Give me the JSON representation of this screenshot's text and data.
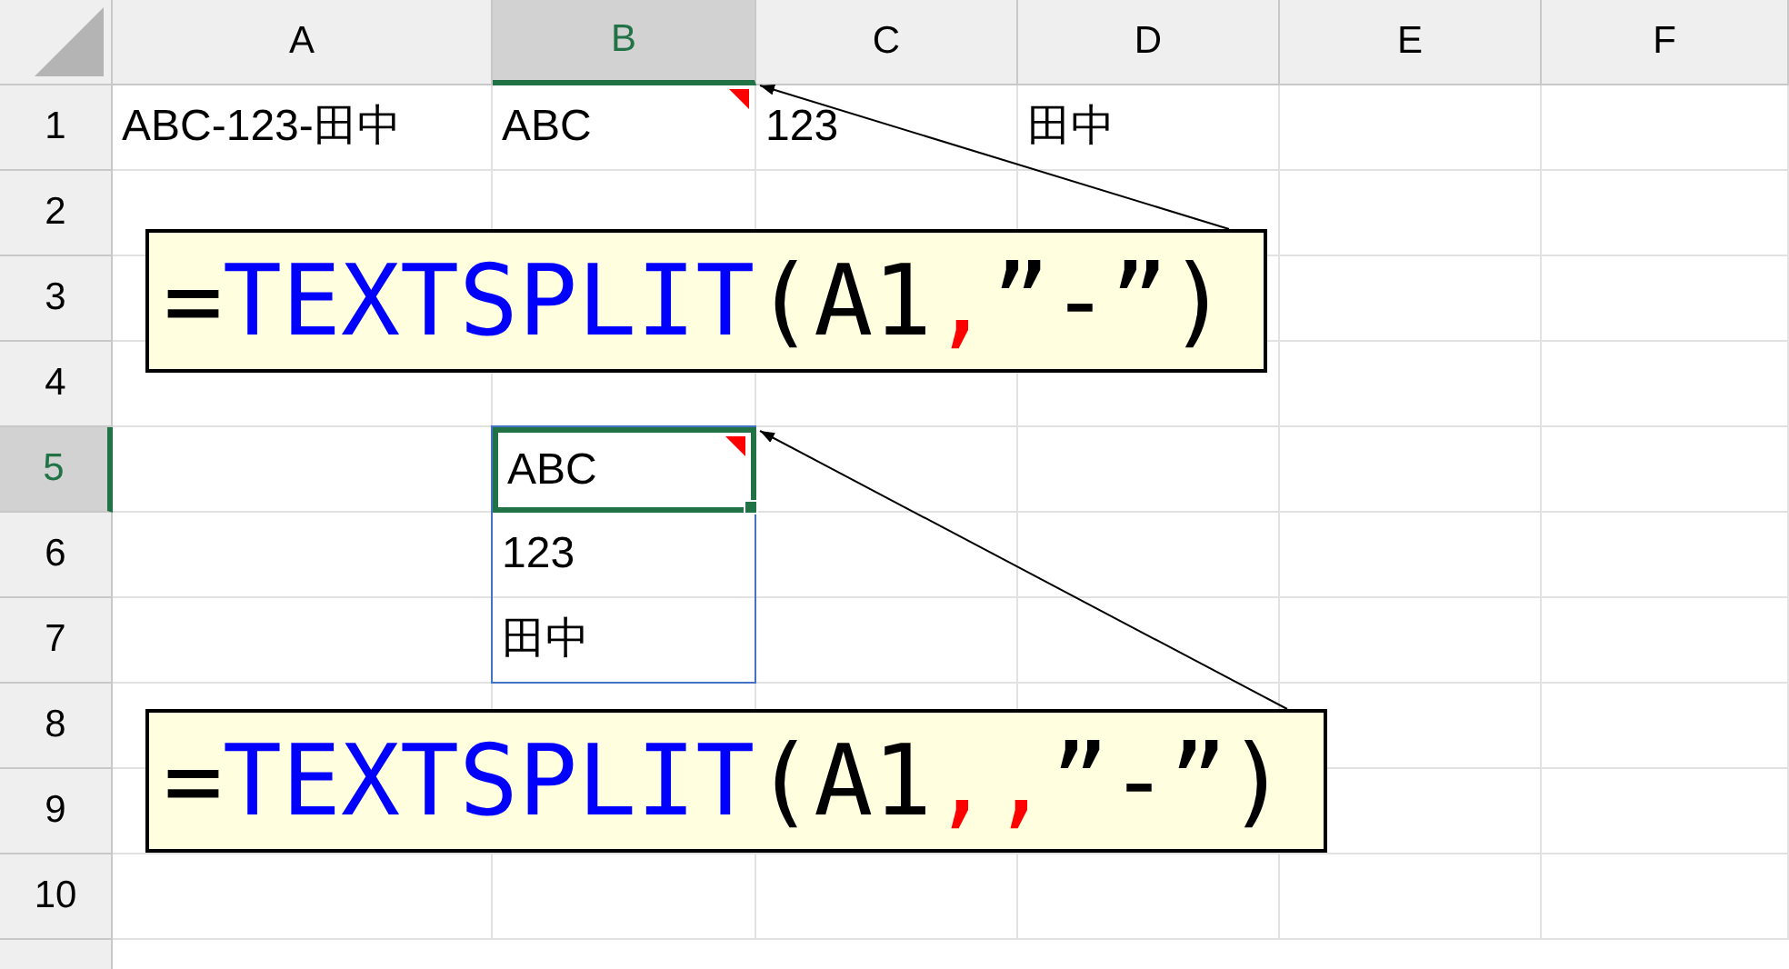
{
  "columns": [
    {
      "label": "A",
      "selected": false
    },
    {
      "label": "B",
      "selected": true
    },
    {
      "label": "C",
      "selected": false
    },
    {
      "label": "D",
      "selected": false
    },
    {
      "label": "E",
      "selected": false
    },
    {
      "label": "F",
      "selected": false
    }
  ],
  "rows": [
    {
      "label": "1",
      "selected": false,
      "cells": [
        {
          "text": "ABC-123-田中"
        },
        {
          "text": "ABC",
          "note": true
        },
        {
          "text": "123"
        },
        {
          "text": "田中"
        },
        null,
        null
      ]
    },
    {
      "label": "2",
      "selected": false,
      "cells": [
        null,
        null,
        null,
        null,
        null,
        null
      ]
    },
    {
      "label": "3",
      "selected": false,
      "cells": [
        null,
        null,
        null,
        null,
        null,
        null
      ]
    },
    {
      "label": "4",
      "selected": false,
      "cells": [
        null,
        null,
        null,
        null,
        null,
        null
      ]
    },
    {
      "label": "5",
      "selected": true,
      "cells": [
        null,
        {
          "text": "ABC",
          "note": true,
          "selected": true,
          "spill": true
        },
        null,
        null,
        null,
        null
      ]
    },
    {
      "label": "6",
      "selected": false,
      "cells": [
        null,
        {
          "text": "123",
          "spill": true
        },
        null,
        null,
        null,
        null
      ]
    },
    {
      "label": "7",
      "selected": false,
      "cells": [
        null,
        {
          "text": "田中",
          "spill": true
        },
        null,
        null,
        null,
        null
      ]
    },
    {
      "label": "8",
      "selected": false,
      "cells": [
        null,
        null,
        null,
        null,
        null,
        null
      ]
    },
    {
      "label": "9",
      "selected": false,
      "cells": [
        null,
        null,
        null,
        null,
        null,
        null
      ]
    },
    {
      "label": "10",
      "selected": false,
      "cells": [
        null,
        null,
        null,
        null,
        null,
        null
      ]
    }
  ],
  "callouts": [
    {
      "parts": [
        {
          "kind": "plain",
          "text": "="
        },
        {
          "kind": "function",
          "text": "TEXTSPLIT"
        },
        {
          "kind": "plain",
          "text": "(A1"
        },
        {
          "kind": "separator",
          "text": ","
        },
        {
          "kind": "plain",
          "text": "”-”)"
        }
      ]
    },
    {
      "parts": [
        {
          "kind": "plain",
          "text": "="
        },
        {
          "kind": "function",
          "text": "TEXTSPLIT"
        },
        {
          "kind": "plain",
          "text": "(A1"
        },
        {
          "kind": "separator",
          "text": ",,"
        },
        {
          "kind": "plain",
          "text": "”-”)"
        }
      ]
    }
  ]
}
